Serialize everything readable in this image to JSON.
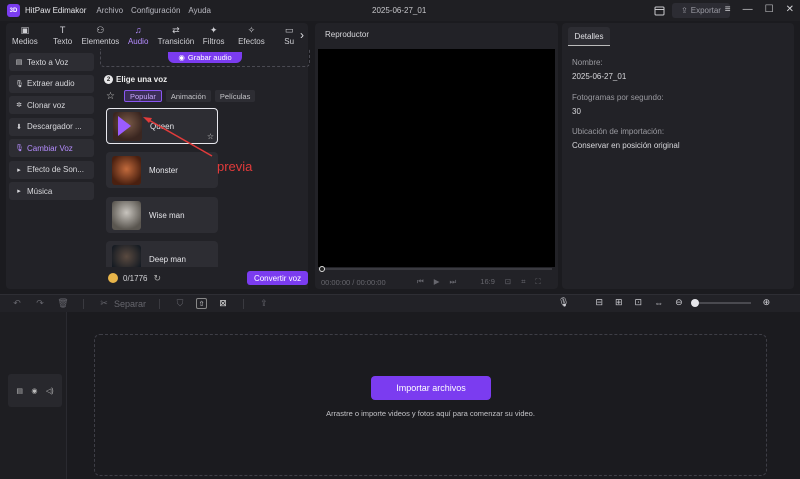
{
  "app": {
    "logo_text": "3D",
    "title": "HitPaw Edimakor",
    "project_name": "2025-06-27_01"
  },
  "menu": [
    "Archivo",
    "Configuración",
    "Ayuda"
  ],
  "titlebar": {
    "export_label": "Exportar"
  },
  "category_tabs": [
    {
      "label": "Medios",
      "icon": "▣"
    },
    {
      "label": "Texto",
      "icon": "T"
    },
    {
      "label": "Elementos",
      "icon": "⚇"
    },
    {
      "label": "Audio",
      "icon": "♫"
    },
    {
      "label": "Transición",
      "icon": "⇄"
    },
    {
      "label": "Filtros",
      "icon": "✦"
    },
    {
      "label": "Efectos",
      "icon": "✧"
    },
    {
      "label": "Su",
      "icon": "▭"
    }
  ],
  "audio_menu": [
    {
      "label": "Texto a Voz",
      "icon": "▤"
    },
    {
      "label": "Extraer audio",
      "icon": "🎙"
    },
    {
      "label": "Clonar voz",
      "icon": "✲"
    },
    {
      "label": "Descargador ...",
      "icon": "⬇"
    },
    {
      "label": "Cambiar Voz",
      "icon": "🎙"
    },
    {
      "label": "Efecto de Son...",
      "icon": "▸"
    },
    {
      "label": "Música",
      "icon": "▸"
    }
  ],
  "voice_panel": {
    "record_label": "Grabar audio",
    "step_number": "2",
    "title": "Elige una voz",
    "filters": [
      "Popular",
      "Animación",
      "Películas"
    ],
    "voices": [
      {
        "name": "Queen"
      },
      {
        "name": "Monster"
      },
      {
        "name": "Wise man"
      },
      {
        "name": "Deep man"
      }
    ],
    "credits": "0/1776",
    "convert_label": "Convertir voz"
  },
  "annotation": {
    "text": "previa",
    "color": "#e13b3b"
  },
  "player": {
    "title": "Reproductor",
    "time": "00:00:00 / 00:00:00",
    "aspect": "16:9"
  },
  "details": {
    "tab": "Detalles",
    "rows": [
      {
        "label": "Nombre:",
        "value": "2025-06-27_01"
      },
      {
        "label": "Fotogramas por segundo:",
        "value": "30"
      },
      {
        "label": "Ubicación de importación:",
        "value": "Conservar en posición original"
      }
    ]
  },
  "timeline": {
    "split_label": "Separar",
    "import_label": "Importar archivos",
    "drop_hint": "Arrastre o importe videos y fotos aquí para comenzar su video.",
    "zoom_level": 0
  },
  "colors": {
    "accent": "#7b3cf0",
    "active_text": "#b58cff",
    "annotation": "#e13b3b"
  }
}
